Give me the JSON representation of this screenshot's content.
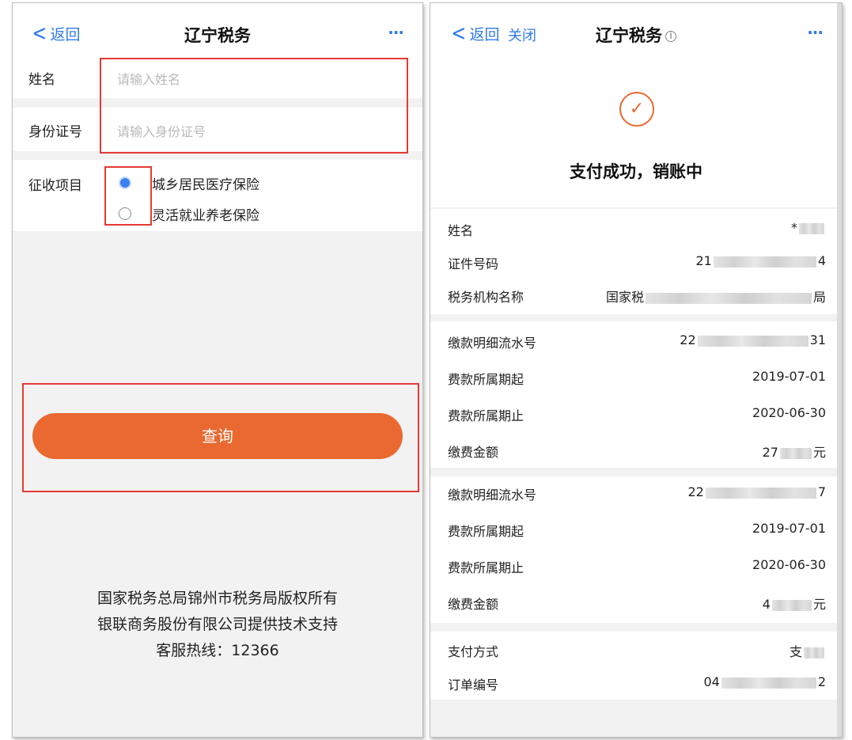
{
  "left": {
    "nav": {
      "back": "返回",
      "title": "辽宁税务",
      "more": "···"
    },
    "form": {
      "name_label": "姓名",
      "name_placeholder": "请输入姓名",
      "id_label": "身份证号",
      "id_placeholder": "请输入身份证号",
      "item_label": "征收项目",
      "options": [
        {
          "label": "城乡居民医疗保险",
          "selected": true
        },
        {
          "label": "灵活就业养老保险",
          "selected": false
        }
      ]
    },
    "query_button": "查询",
    "footer": [
      "国家税务总局锦州市税务局版权所有",
      "银联商务股份有限公司提供技术支持",
      "客服热线：12366"
    ]
  },
  "right": {
    "nav": {
      "back": "返回",
      "close": "关闭",
      "title": "辽宁税务",
      "more": "···"
    },
    "status": "支付成功，销账中",
    "info": {
      "name_label": "姓名",
      "name_prefix": "*",
      "id_label": "证件号码",
      "id_prefix": "21",
      "id_suffix": "4",
      "org_label": "税务机构名称",
      "org_prefix": "国家税",
      "org_suffix": "局"
    },
    "records": [
      {
        "serial_label": "缴款明细流水号",
        "serial_prefix": "22",
        "serial_suffix": "31",
        "start_label": "费款所属期起",
        "start": "2019-07-01",
        "end_label": "费款所属期止",
        "end": "2020-06-30",
        "amount_label": "缴费金额",
        "amount_prefix": "27",
        "amount_suffix": "元"
      },
      {
        "serial_label": "缴款明细流水号",
        "serial_prefix": "22",
        "serial_suffix": "7",
        "start_label": "费款所属期起",
        "start": "2019-07-01",
        "end_label": "费款所属期止",
        "end": "2020-06-30",
        "amount_label": "缴费金额",
        "amount_prefix": "4",
        "amount_suffix": "元"
      }
    ],
    "payment": {
      "method_label": "支付方式",
      "method_prefix": "支",
      "order_label": "订单编号",
      "order_prefix": "04",
      "order_suffix": "2"
    }
  }
}
